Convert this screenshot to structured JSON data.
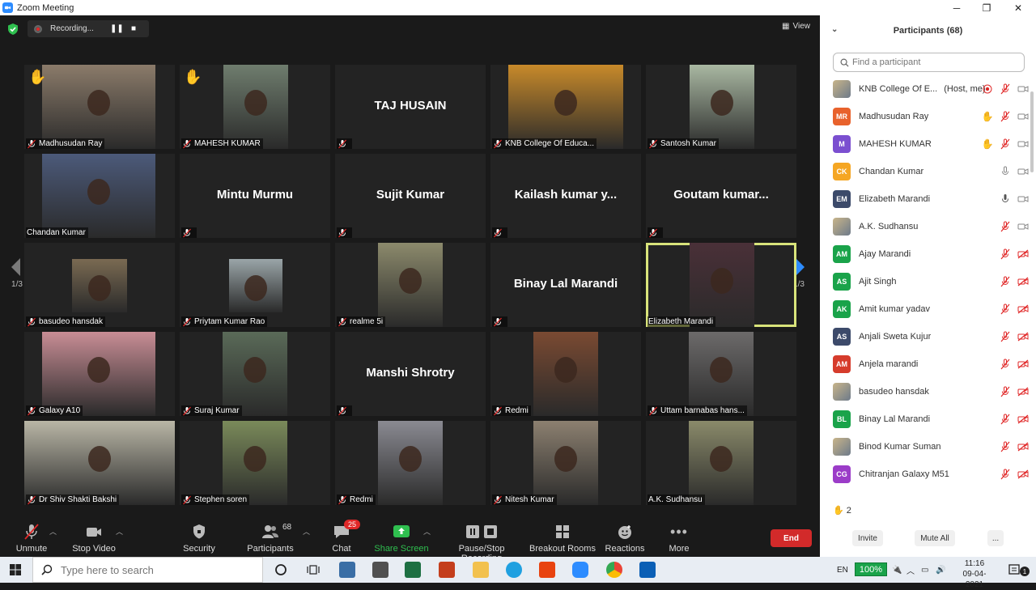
{
  "window": {
    "title": "Zoom Meeting",
    "minimize": "─",
    "maximize": "❐",
    "close": "✕"
  },
  "recording": {
    "text": "Recording..."
  },
  "view_label": "View",
  "page_indicator": "1/3",
  "tiles": [
    {
      "name": "Madhusudan Ray",
      "video": true,
      "hand": true,
      "vleft": 22,
      "vw": 140,
      "color": "#8b7b6a",
      "muted": true
    },
    {
      "name": "MAHESH KUMAR",
      "video": true,
      "hand": true,
      "vleft": 54,
      "vw": 80,
      "color": "#6f7d6e",
      "muted": true
    },
    {
      "name": "",
      "bigname": "TAJ HUSAIN",
      "video": false,
      "muted": true
    },
    {
      "name": "KNB College Of Educa...",
      "video": true,
      "vleft": 22,
      "vw": 142,
      "color": "#c88a2a",
      "muted": true
    },
    {
      "name": "Santosh Kumar",
      "video": true,
      "vleft": 54,
      "vw": 80,
      "color": "#a9b8a2",
      "muted": true
    },
    {
      "name": "Chandan Kumar",
      "video": true,
      "vleft": 22,
      "vw": 140,
      "color": "#4c5a7a",
      "muted": false
    },
    {
      "name": "",
      "bigname": "Mintu Murmu",
      "video": false,
      "muted": true
    },
    {
      "name": "",
      "bigname": "Sujit Kumar",
      "video": false,
      "muted": true
    },
    {
      "name": "",
      "bigname": "Kailash kumar y...",
      "video": false,
      "muted": true
    },
    {
      "name": "",
      "bigname": "Goutam kumar...",
      "video": false,
      "muted": true
    },
    {
      "name": "basudeo hansdak",
      "video": true,
      "vleft": 59,
      "vw": 68,
      "vtop": 20,
      "vh": 66,
      "color": "#7a6a52",
      "muted": true
    },
    {
      "name": "Priytam Kumar Rao",
      "video": true,
      "vleft": 61,
      "vw": 66,
      "vtop": 20,
      "vh": 66,
      "color": "#9aa5a8",
      "muted": true
    },
    {
      "name": "realme 5i",
      "video": true,
      "vleft": 53,
      "vw": 80,
      "color": "#8c8a6c",
      "muted": true
    },
    {
      "name": "",
      "bigname": "Binay Lal Marandi",
      "video": false,
      "muted": true
    },
    {
      "name": "Elizabeth Marandi",
      "video": true,
      "vleft": 54,
      "vw": 80,
      "color": "#4a3038",
      "muted": false,
      "active": true
    },
    {
      "name": "Galaxy A10",
      "video": true,
      "vleft": 22,
      "vw": 140,
      "color": "#c88d95",
      "muted": true
    },
    {
      "name": "Suraj Kumar",
      "video": true,
      "vleft": 53,
      "vw": 80,
      "color": "#5a6a58",
      "muted": true
    },
    {
      "name": "",
      "bigname": "Manshi Shrotry",
      "video": false,
      "muted": true
    },
    {
      "name": "Redmi",
      "video": true,
      "vleft": 53,
      "vw": 80,
      "color": "#7a4a32",
      "muted": true
    },
    {
      "name": "Uttam barnabas hans...",
      "video": true,
      "vleft": 53,
      "vw": 80,
      "color": "#6c6a6a",
      "muted": true
    },
    {
      "name": "Dr Shiv Shakti Bakshi",
      "video": true,
      "vleft": 0,
      "vw": 186,
      "color": "#b9b6a6",
      "muted": true
    },
    {
      "name": "Stephen soren",
      "video": true,
      "vleft": 53,
      "vw": 80,
      "color": "#7a8a5a",
      "muted": true
    },
    {
      "name": "Redmi",
      "video": true,
      "vleft": 53,
      "vw": 80,
      "color": "#8a8a92",
      "muted": true
    },
    {
      "name": "Nitesh Kumar",
      "video": true,
      "vleft": 53,
      "vw": 80,
      "color": "#8c8070",
      "muted": true
    },
    {
      "name": "A.K. Sudhansu",
      "video": true,
      "vleft": 53,
      "vw": 80,
      "color": "#8a8a6a",
      "muted": false
    }
  ],
  "toolbar": {
    "unmute": "Unmute",
    "stop_video": "Stop Video",
    "security": "Security",
    "participants": "Participants",
    "participants_count": "68",
    "chat": "Chat",
    "chat_badge": "25",
    "share_screen": "Share Screen",
    "recording": "Pause/Stop Recording",
    "breakout": "Breakout Rooms",
    "reactions": "Reactions",
    "more": "More",
    "end": "End"
  },
  "panel": {
    "title": "Participants (68)",
    "search_placeholder": "Find a participant",
    "hands_raised": "2",
    "invite": "Invite",
    "mute_all": "Mute All",
    "more": "...",
    "participants": [
      {
        "name": "KNB College Of E...",
        "host": "(Host, me)",
        "initials": "",
        "color": "",
        "photo": true,
        "state": "rec"
      },
      {
        "name": "Madhusudan Ray",
        "initials": "MR",
        "color": "#e8622c",
        "state": "hand"
      },
      {
        "name": "MAHESH KUMAR",
        "initials": "M",
        "color": "#7b4fd0",
        "state": "hand"
      },
      {
        "name": "Chandan Kumar",
        "initials": "CK",
        "color": "#f5a623",
        "state": "mic"
      },
      {
        "name": "Elizabeth Marandi",
        "initials": "EM",
        "color": "#3c4a6a",
        "state": "micdark"
      },
      {
        "name": "A.K. Sudhansu",
        "initials": "",
        "color": "",
        "photo": true,
        "state": "muted"
      },
      {
        "name": "Ajay Marandi",
        "initials": "AM",
        "color": "#1aa34a",
        "state": "mutedoff"
      },
      {
        "name": "Ajit Singh",
        "initials": "AS",
        "color": "#1aa34a",
        "state": "mutedoff"
      },
      {
        "name": "Amit kumar yadav",
        "initials": "AK",
        "color": "#1aa34a",
        "state": "mutedoff"
      },
      {
        "name": "Anjali Sweta Kujur",
        "initials": "AS",
        "color": "#3c4a6a",
        "state": "mutedoff"
      },
      {
        "name": "Anjela marandi",
        "initials": "AM",
        "color": "#d63c2c",
        "state": "mutedoff"
      },
      {
        "name": "basudeo hansdak",
        "initials": "",
        "color": "",
        "photo": true,
        "state": "mutedoff"
      },
      {
        "name": "Binay Lal Marandi",
        "initials": "BL",
        "color": "#1aa34a",
        "state": "mutedoff"
      },
      {
        "name": "Binod Kumar Suman",
        "initials": "",
        "color": "",
        "photo": true,
        "state": "mutedoff"
      },
      {
        "name": "Chitranjan Galaxy M51",
        "initials": "CG",
        "color": "#9b3cc8",
        "state": "mutedoff"
      }
    ]
  },
  "taskbar": {
    "search_placeholder": "Type here to search",
    "lang": "EN",
    "battery": "100%",
    "time": "11:16",
    "date": "09-04-2021"
  }
}
